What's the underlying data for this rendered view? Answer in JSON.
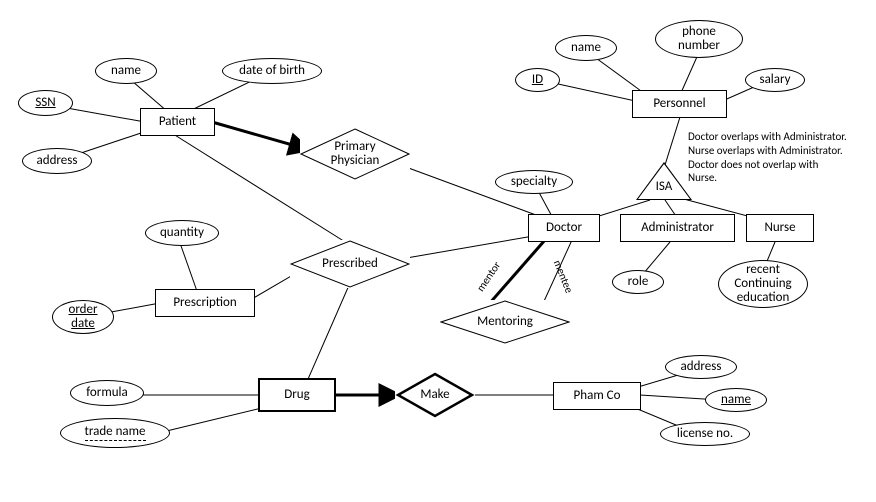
{
  "diagram_type": "Entity-Relationship Diagram",
  "entities": {
    "patient": "Patient",
    "personnel": "Personnel",
    "doctor": "Doctor",
    "administrator": "Administrator",
    "nurse": "Nurse",
    "prescription": "Prescription",
    "drug": "Drug",
    "pham_co": "Pham Co"
  },
  "attributes": {
    "patient": {
      "name": "name",
      "dob": "date of birth",
      "ssn": "SSN",
      "address": "address"
    },
    "personnel": {
      "name": "name",
      "phone": "phone\nnumber",
      "id": "ID",
      "salary": "salary"
    },
    "doctor": {
      "specialty": "specialty"
    },
    "administrator": {
      "role": "role"
    },
    "nurse": {
      "rce": "recent\nContinuing\neducation"
    },
    "prescription": {
      "quantity": "quantity",
      "order_date": "order\ndate"
    },
    "drug": {
      "formula": "formula",
      "trade_name": "trade name"
    },
    "pham_co": {
      "address": "address",
      "name": "name",
      "license": "license no."
    }
  },
  "relationships": {
    "primary_physician": "Primary\nPhysician",
    "prescribed": "Prescribed",
    "mentoring": "Mentoring",
    "make": "Make",
    "isa": "ISA"
  },
  "role_labels": {
    "mentor": "mentor",
    "mentee": "mentee"
  },
  "note": "Doctor overlaps with Administrator.\nNurse overlaps with Administrator.\nDoctor does not overlap with\nNurse."
}
